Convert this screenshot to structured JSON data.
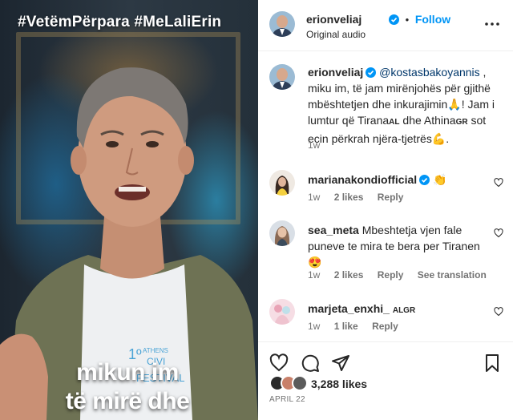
{
  "media": {
    "hashtags": "#VetëmPërpara  #MeLaliErin",
    "subtitle_line1": "mikun im",
    "subtitle_line2": "të mirë dhe",
    "shirt_text_top": "1º",
    "shirt_text_athens": "ATHENS",
    "shirt_text_civic": "CIVI",
    "shirt_text_festival": "FESTIVAL"
  },
  "header": {
    "username": "erionveliaj",
    "separator": "•",
    "follow_label": "Follow",
    "audio": "Original audio",
    "more_icon": "more-horizontal-icon"
  },
  "caption": {
    "username": "erionveliaj",
    "mention": "@kostasbakoyannis",
    "text_part1": " , miku im, të jam mirënjohës për gjithë mbështetjen dhe inkurajimin",
    "emoji_pray": "🙏",
    "text_part2": "! Jam i lumtur që Tirana",
    "tag_al": "AL",
    "text_part3": " dhe Athina",
    "tag_gr": "GR",
    "text_part4": " sot ecin përkrah njëra-tjetrës",
    "emoji_muscle": "💪",
    "text_part5": ".",
    "time": "1w"
  },
  "comments": [
    {
      "username": "marianakondiofficial",
      "verified": true,
      "text": "👏",
      "time": "1w",
      "likes": "2 likes",
      "reply": "Reply",
      "translation": ""
    },
    {
      "username": "sea_meta",
      "verified": false,
      "text": "Mbeshtetja vjen fale puneve te mira te bera per Tiranen 😍",
      "time": "1w",
      "likes": "2 likes",
      "reply": "Reply",
      "translation": "See translation"
    },
    {
      "username": "marjeta_enxhi_",
      "verified": false,
      "tag": "ALGR",
      "text": "",
      "time": "1w",
      "likes": "1 like",
      "reply": "Reply",
      "translation": ""
    }
  ],
  "footer": {
    "likes_count": "3,288 likes",
    "date": "APRIL 22",
    "icons": [
      "heart-icon",
      "comment-icon",
      "share-icon",
      "bookmark-icon"
    ]
  },
  "colors": {
    "accent": "#0095f6",
    "verified": "#0095f6",
    "mention": "#00376b",
    "muted": "#737373",
    "text": "#262626"
  }
}
